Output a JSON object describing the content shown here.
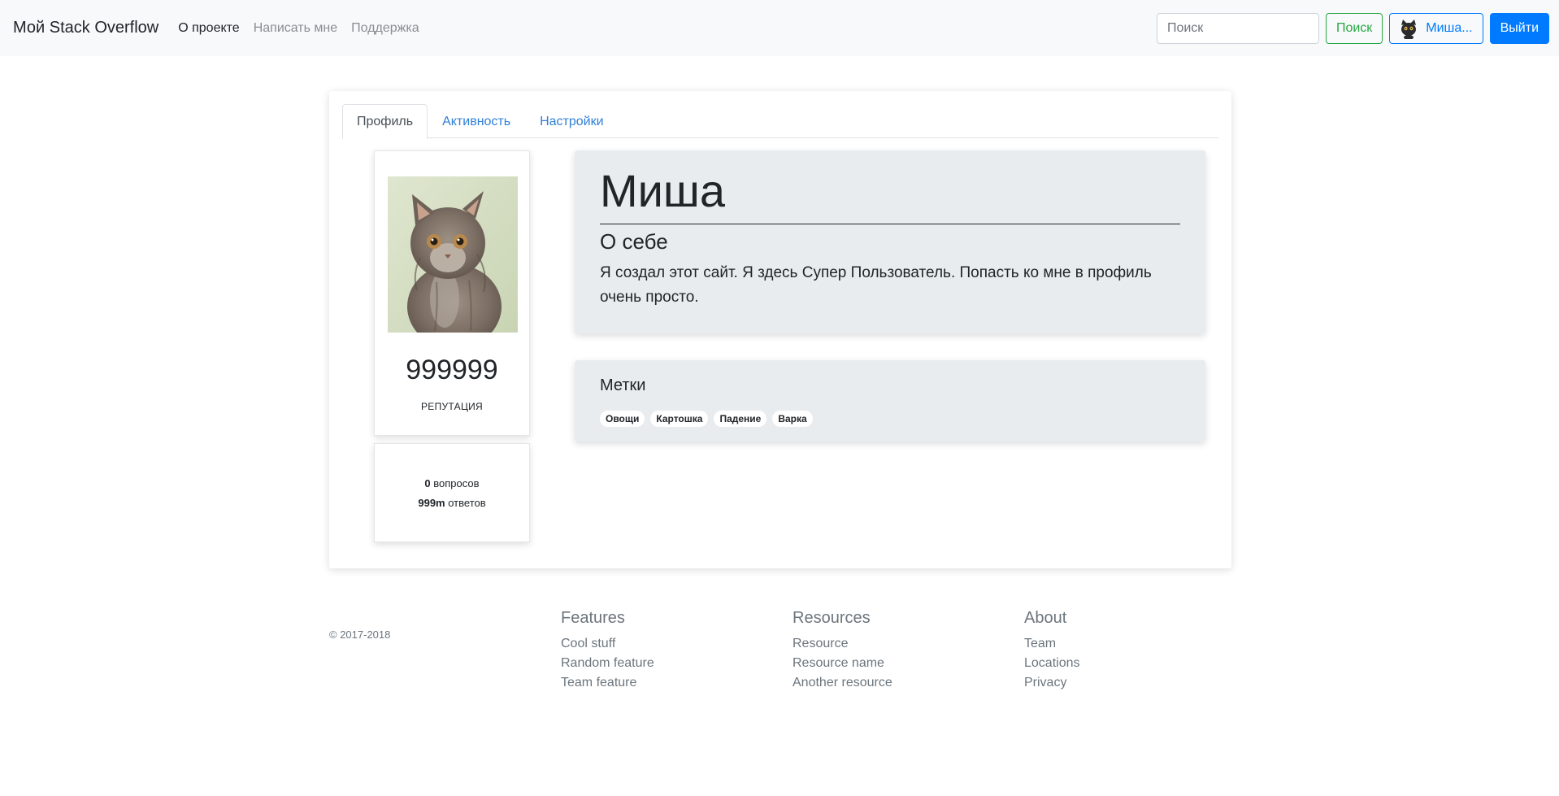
{
  "navbar": {
    "brand": "Мой Stack Overflow",
    "links": [
      "О проекте",
      "Написать мне",
      "Поддержка"
    ],
    "search_placeholder": "Поиск",
    "search_button": "Поиск",
    "user_button": "Миша...",
    "logout_button": "Выйти"
  },
  "tabs": [
    "Профиль",
    "Активность",
    "Настройки"
  ],
  "profile": {
    "reputation_value": "999999",
    "reputation_label": "РЕПУТАЦИЯ",
    "questions_count": "0",
    "questions_label": "вопросов",
    "answers_count": "999m",
    "answers_label": "ответов",
    "name": "Миша",
    "about_title": "О себе",
    "about_text": "Я создал этот сайт. Я здесь Супер Пользователь. Попасть ко мне в профиль очень просто.",
    "tags_title": "Метки",
    "tags": [
      "Овощи",
      "Картошка",
      "Падение",
      "Варка"
    ]
  },
  "footer": {
    "copyright": "© 2017-2018",
    "columns": [
      {
        "title": "Features",
        "links": [
          "Cool stuff",
          "Random feature",
          "Team feature"
        ]
      },
      {
        "title": "Resources",
        "links": [
          "Resource",
          "Resource name",
          "Another resource"
        ]
      },
      {
        "title": "About",
        "links": [
          "Team",
          "Locations",
          "Privacy"
        ]
      }
    ]
  },
  "colors": {
    "primary": "#007bff",
    "success": "#28a745",
    "navbar_bg": "#f8f9fa",
    "jumbotron_bg": "#e9ecef"
  },
  "icons": {
    "user_avatar": "cat-avatar-icon",
    "profile_photo": "kitten-photo"
  }
}
